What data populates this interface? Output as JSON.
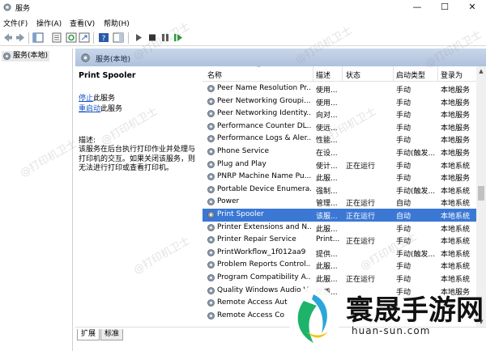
{
  "window": {
    "title": "服务",
    "controls": {
      "minimize": "—",
      "maximize": "☐",
      "close": "✕"
    }
  },
  "menu": [
    "文件(F)",
    "操作(A)",
    "查看(V)",
    "帮助(H)"
  ],
  "toolbar": {
    "icons": [
      "back-icon",
      "forward-icon",
      "console-tree-icon",
      "properties-icon",
      "refresh-icon",
      "export-icon",
      "help-icon",
      "show-hide-icon",
      "start-icon",
      "stop-icon",
      "pause-icon",
      "restart-icon"
    ]
  },
  "tree": {
    "root_label": "服务(本地)"
  },
  "main_header": {
    "title": "服务(本地)"
  },
  "description": {
    "service_name": "Print Spooler",
    "stop_link": "停止",
    "stop_suffix": "此服务",
    "restart_link": "重启动",
    "restart_suffix": "此服务",
    "label": "描述:",
    "text": "该服务在后台执行打印作业并处理与打印机的交互。如果关闭该服务，则无法进行打印或查看打印机。"
  },
  "columns": {
    "name": "名称",
    "desc": "描述",
    "status": "状态",
    "startup": "启动类型",
    "logon": "登录为"
  },
  "services": [
    {
      "name": "Peer Name Resolution Pr...",
      "desc": "使用...",
      "status": "",
      "startup": "手动",
      "logon": "本地服务"
    },
    {
      "name": "Peer Networking Groupi...",
      "desc": "使用...",
      "status": "",
      "startup": "手动",
      "logon": "本地服务"
    },
    {
      "name": "Peer Networking Identity...",
      "desc": "向对...",
      "status": "",
      "startup": "手动",
      "logon": "本地服务"
    },
    {
      "name": "Performance Counter DL...",
      "desc": "使远...",
      "status": "",
      "startup": "手动",
      "logon": "本地服务"
    },
    {
      "name": "Performance Logs & Aler...",
      "desc": "性能...",
      "status": "",
      "startup": "手动",
      "logon": "本地服务"
    },
    {
      "name": "Phone Service",
      "desc": "在设...",
      "status": "",
      "startup": "手动(触发...",
      "logon": "本地服务"
    },
    {
      "name": "Plug and Play",
      "desc": "使计...",
      "status": "正在运行",
      "startup": "手动",
      "logon": "本地系统"
    },
    {
      "name": "PNRP Machine Name Pu...",
      "desc": "此服...",
      "status": "",
      "startup": "手动",
      "logon": "本地服务"
    },
    {
      "name": "Portable Device Enumera...",
      "desc": "强制...",
      "status": "",
      "startup": "手动(触发...",
      "logon": "本地系统"
    },
    {
      "name": "Power",
      "desc": "管理...",
      "status": "正在运行",
      "startup": "自动",
      "logon": "本地系统"
    },
    {
      "name": "Print Spooler",
      "desc": "该服...",
      "status": "正在运行",
      "startup": "自动",
      "logon": "本地系统",
      "selected": true
    },
    {
      "name": "Printer Extensions and N...",
      "desc": "此服...",
      "status": "",
      "startup": "手动",
      "logon": "本地系统"
    },
    {
      "name": "Printer Repair Service",
      "desc": "Print...",
      "status": "正在运行",
      "startup": "手动",
      "logon": "本地系统"
    },
    {
      "name": "PrintWorkflow_1f012aa9",
      "desc": "提供...",
      "status": "",
      "startup": "手动(触发...",
      "logon": "本地系统"
    },
    {
      "name": "Problem Reports Control...",
      "desc": "此服...",
      "status": "",
      "startup": "手动",
      "logon": "本地系统"
    },
    {
      "name": "Program Compatibility A...",
      "desc": "此服...",
      "status": "正在运行",
      "startup": "手动",
      "logon": "本地系统"
    },
    {
      "name": "Quality Windows Audio V...",
      "desc": "优质...",
      "status": "",
      "startup": "手动",
      "logon": "本地服务"
    },
    {
      "name": "Remote Access Aut",
      "desc": "",
      "status": "",
      "startup": "",
      "logon": ""
    },
    {
      "name": "Remote Access Co",
      "desc": "",
      "status": "",
      "startup": "",
      "logon": ""
    }
  ],
  "tabs": [
    "扩展",
    "标准"
  ],
  "watermark": "@打印机卫士",
  "logo": {
    "text": "寰晟手游网",
    "url": "huan-sun.com"
  },
  "colors": {
    "selection": "#3b78d4",
    "header_gradient_top": "#c9d7ea",
    "link": "#1a55c4"
  }
}
